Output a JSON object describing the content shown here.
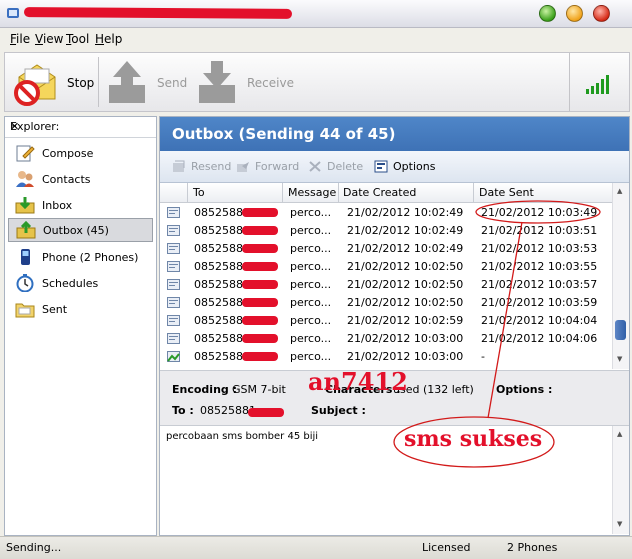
{
  "menu": [
    "File",
    "View",
    "Tool",
    "Help"
  ],
  "toolbar": {
    "stop": "Stop",
    "send": "Send",
    "receive": "Receive"
  },
  "explorer": {
    "header": "Explorer:",
    "items": [
      {
        "icon": "compose-icon",
        "label": "Compose"
      },
      {
        "icon": "contacts-icon",
        "label": "Contacts"
      },
      {
        "icon": "inbox-icon",
        "label": "Inbox"
      },
      {
        "icon": "outbox-icon",
        "label": "Outbox  (45)"
      },
      {
        "icon": "phone-icon",
        "label": "Phone  (2 Phones)"
      },
      {
        "icon": "schedules-icon",
        "label": "Schedules"
      },
      {
        "icon": "sent-icon",
        "label": "Sent"
      }
    ]
  },
  "outbox": {
    "title": "Outbox (Sending 44 of 45)",
    "actions": {
      "resend": "Resend",
      "forward": "Forward",
      "delete": "Delete",
      "options": "Options"
    },
    "columns": [
      "To",
      "Message",
      "Date Created",
      "Date Sent"
    ],
    "rows": [
      {
        "to": "08525881",
        "message": "perco...",
        "created": "21/02/2012 10:02:49",
        "sent": "21/02/2012 10:03:49"
      },
      {
        "to": "08525881",
        "message": "perco...",
        "created": "21/02/2012 10:02:49",
        "sent": "21/02/2012 10:03:51"
      },
      {
        "to": "08525881",
        "message": "perco...",
        "created": "21/02/2012 10:02:49",
        "sent": "21/02/2012 10:03:53"
      },
      {
        "to": "08525881",
        "message": "perco...",
        "created": "21/02/2012 10:02:50",
        "sent": "21/02/2012 10:03:55"
      },
      {
        "to": "08525881",
        "message": "perco...",
        "created": "21/02/2012 10:02:50",
        "sent": "21/02/2012 10:03:57"
      },
      {
        "to": "08525881",
        "message": "perco...",
        "created": "21/02/2012 10:02:50",
        "sent": "21/02/2012 10:03:59"
      },
      {
        "to": "08525881",
        "message": "perco...",
        "created": "21/02/2012 10:02:59",
        "sent": "21/02/2012 10:04:04"
      },
      {
        "to": "08525881",
        "message": "perco...",
        "created": "21/02/2012 10:03:00",
        "sent": "21/02/2012 10:04:06"
      },
      {
        "to": "08525881",
        "message": "perco...",
        "created": "21/02/2012 10:03:00",
        "sent": "-"
      }
    ]
  },
  "details": {
    "encoding_label": "Encoding :",
    "encoding_value": "GSM 7-bit",
    "characters_label": "Characters :",
    "characters_value": "used (132 left)",
    "options_label": "Options :",
    "to_label": "To :",
    "to_value": "08525881",
    "subject_label": "Subject :"
  },
  "message_body": "percobaan sms bomber 45 biji",
  "annotations": {
    "watermark": "an7412",
    "note": "sms sukses"
  },
  "status": {
    "left": "Sending...",
    "license": "Licensed",
    "phones": "2 Phones"
  },
  "colors": {
    "header_blue": "#4a7fc1",
    "redaction": "#e3102b"
  }
}
